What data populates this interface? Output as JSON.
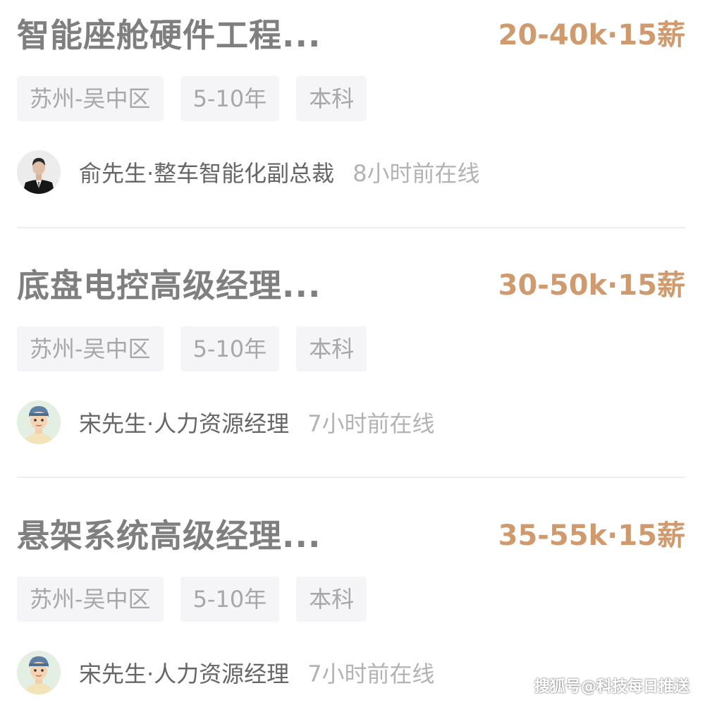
{
  "jobs": [
    {
      "title": "智能座舱硬件工程...",
      "salary": "20-40k·15薪",
      "tags": [
        "苏州-吴中区",
        "5-10年",
        "本科"
      ],
      "recruiter": {
        "name": "俞先生·整车智能化副总裁",
        "online": "8小时前在线",
        "avatar": "businessman-photo-avatar"
      }
    },
    {
      "title": "底盘电控高级经理...",
      "salary": "30-50k·15薪",
      "tags": [
        "苏州-吴中区",
        "5-10年",
        "本科"
      ],
      "recruiter": {
        "name": "宋先生·人力资源经理",
        "online": "7小时前在线",
        "avatar": "cartoon-man-avatar"
      }
    },
    {
      "title": "悬架系统高级经理...",
      "salary": "35-55k·15薪",
      "tags": [
        "苏州-吴中区",
        "5-10年",
        "本科"
      ],
      "recruiter": {
        "name": "宋先生·人力资源经理",
        "online": "7小时前在线",
        "avatar": "cartoon-man-avatar"
      }
    }
  ],
  "watermark": "搜狐号@科技每日推送",
  "colors": {
    "title": "#7f7f7f",
    "salary": "#cf9a6e",
    "tag_bg": "#f5f5f7",
    "tag_text": "#a7a7a7",
    "name": "#666666",
    "online": "#b3b3b3"
  }
}
